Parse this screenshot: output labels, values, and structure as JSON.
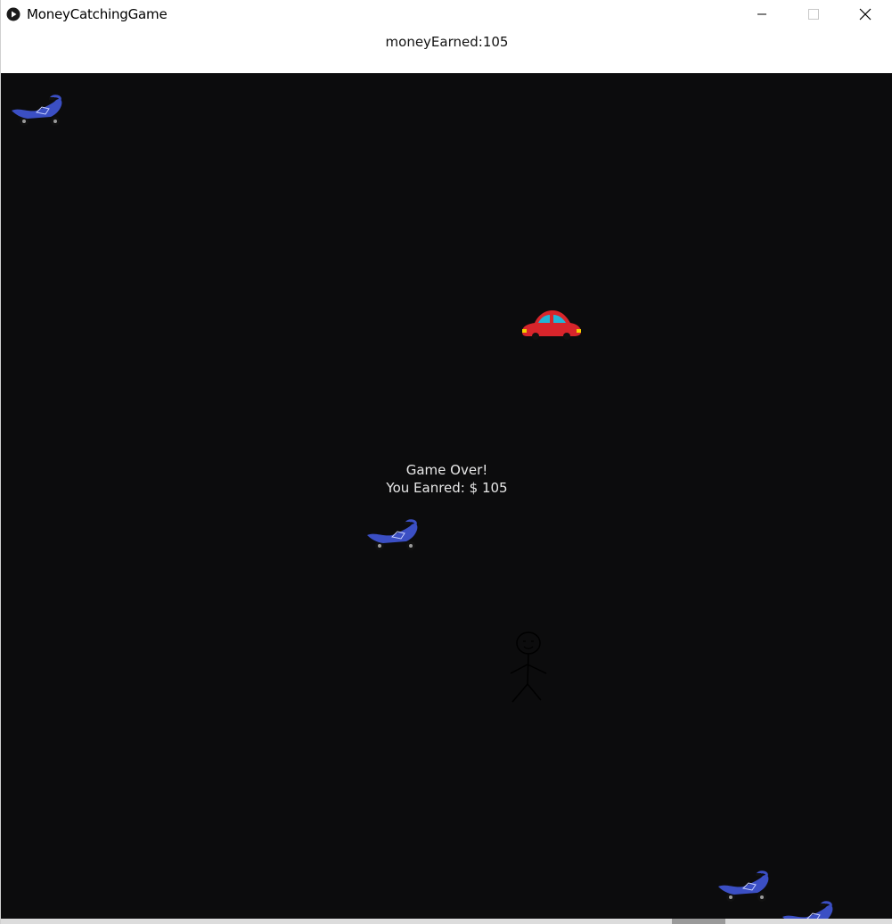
{
  "window": {
    "title": "MoneyCatchingGame",
    "controls": {
      "minimize_icon": "minimize-icon",
      "maximize_icon": "maximize-icon",
      "close_icon": "close-icon"
    }
  },
  "hud": {
    "money_earned_label": "moneyEarned:105"
  },
  "game_over": {
    "line1": "Game Over!",
    "line2": "You Eanred: $ 105"
  },
  "colors": {
    "canvas_background": "#0c0c0d",
    "motorbike_blue": "#3b4fc4",
    "car_red": "#d8252b",
    "car_window": "#22b5d6",
    "text_light": "#e8e8e8"
  },
  "sprites": {
    "motorbike_icon": "motorbike-icon",
    "car_icon": "car-icon",
    "stick_figure_icon": "stick-figure-player-icon"
  }
}
